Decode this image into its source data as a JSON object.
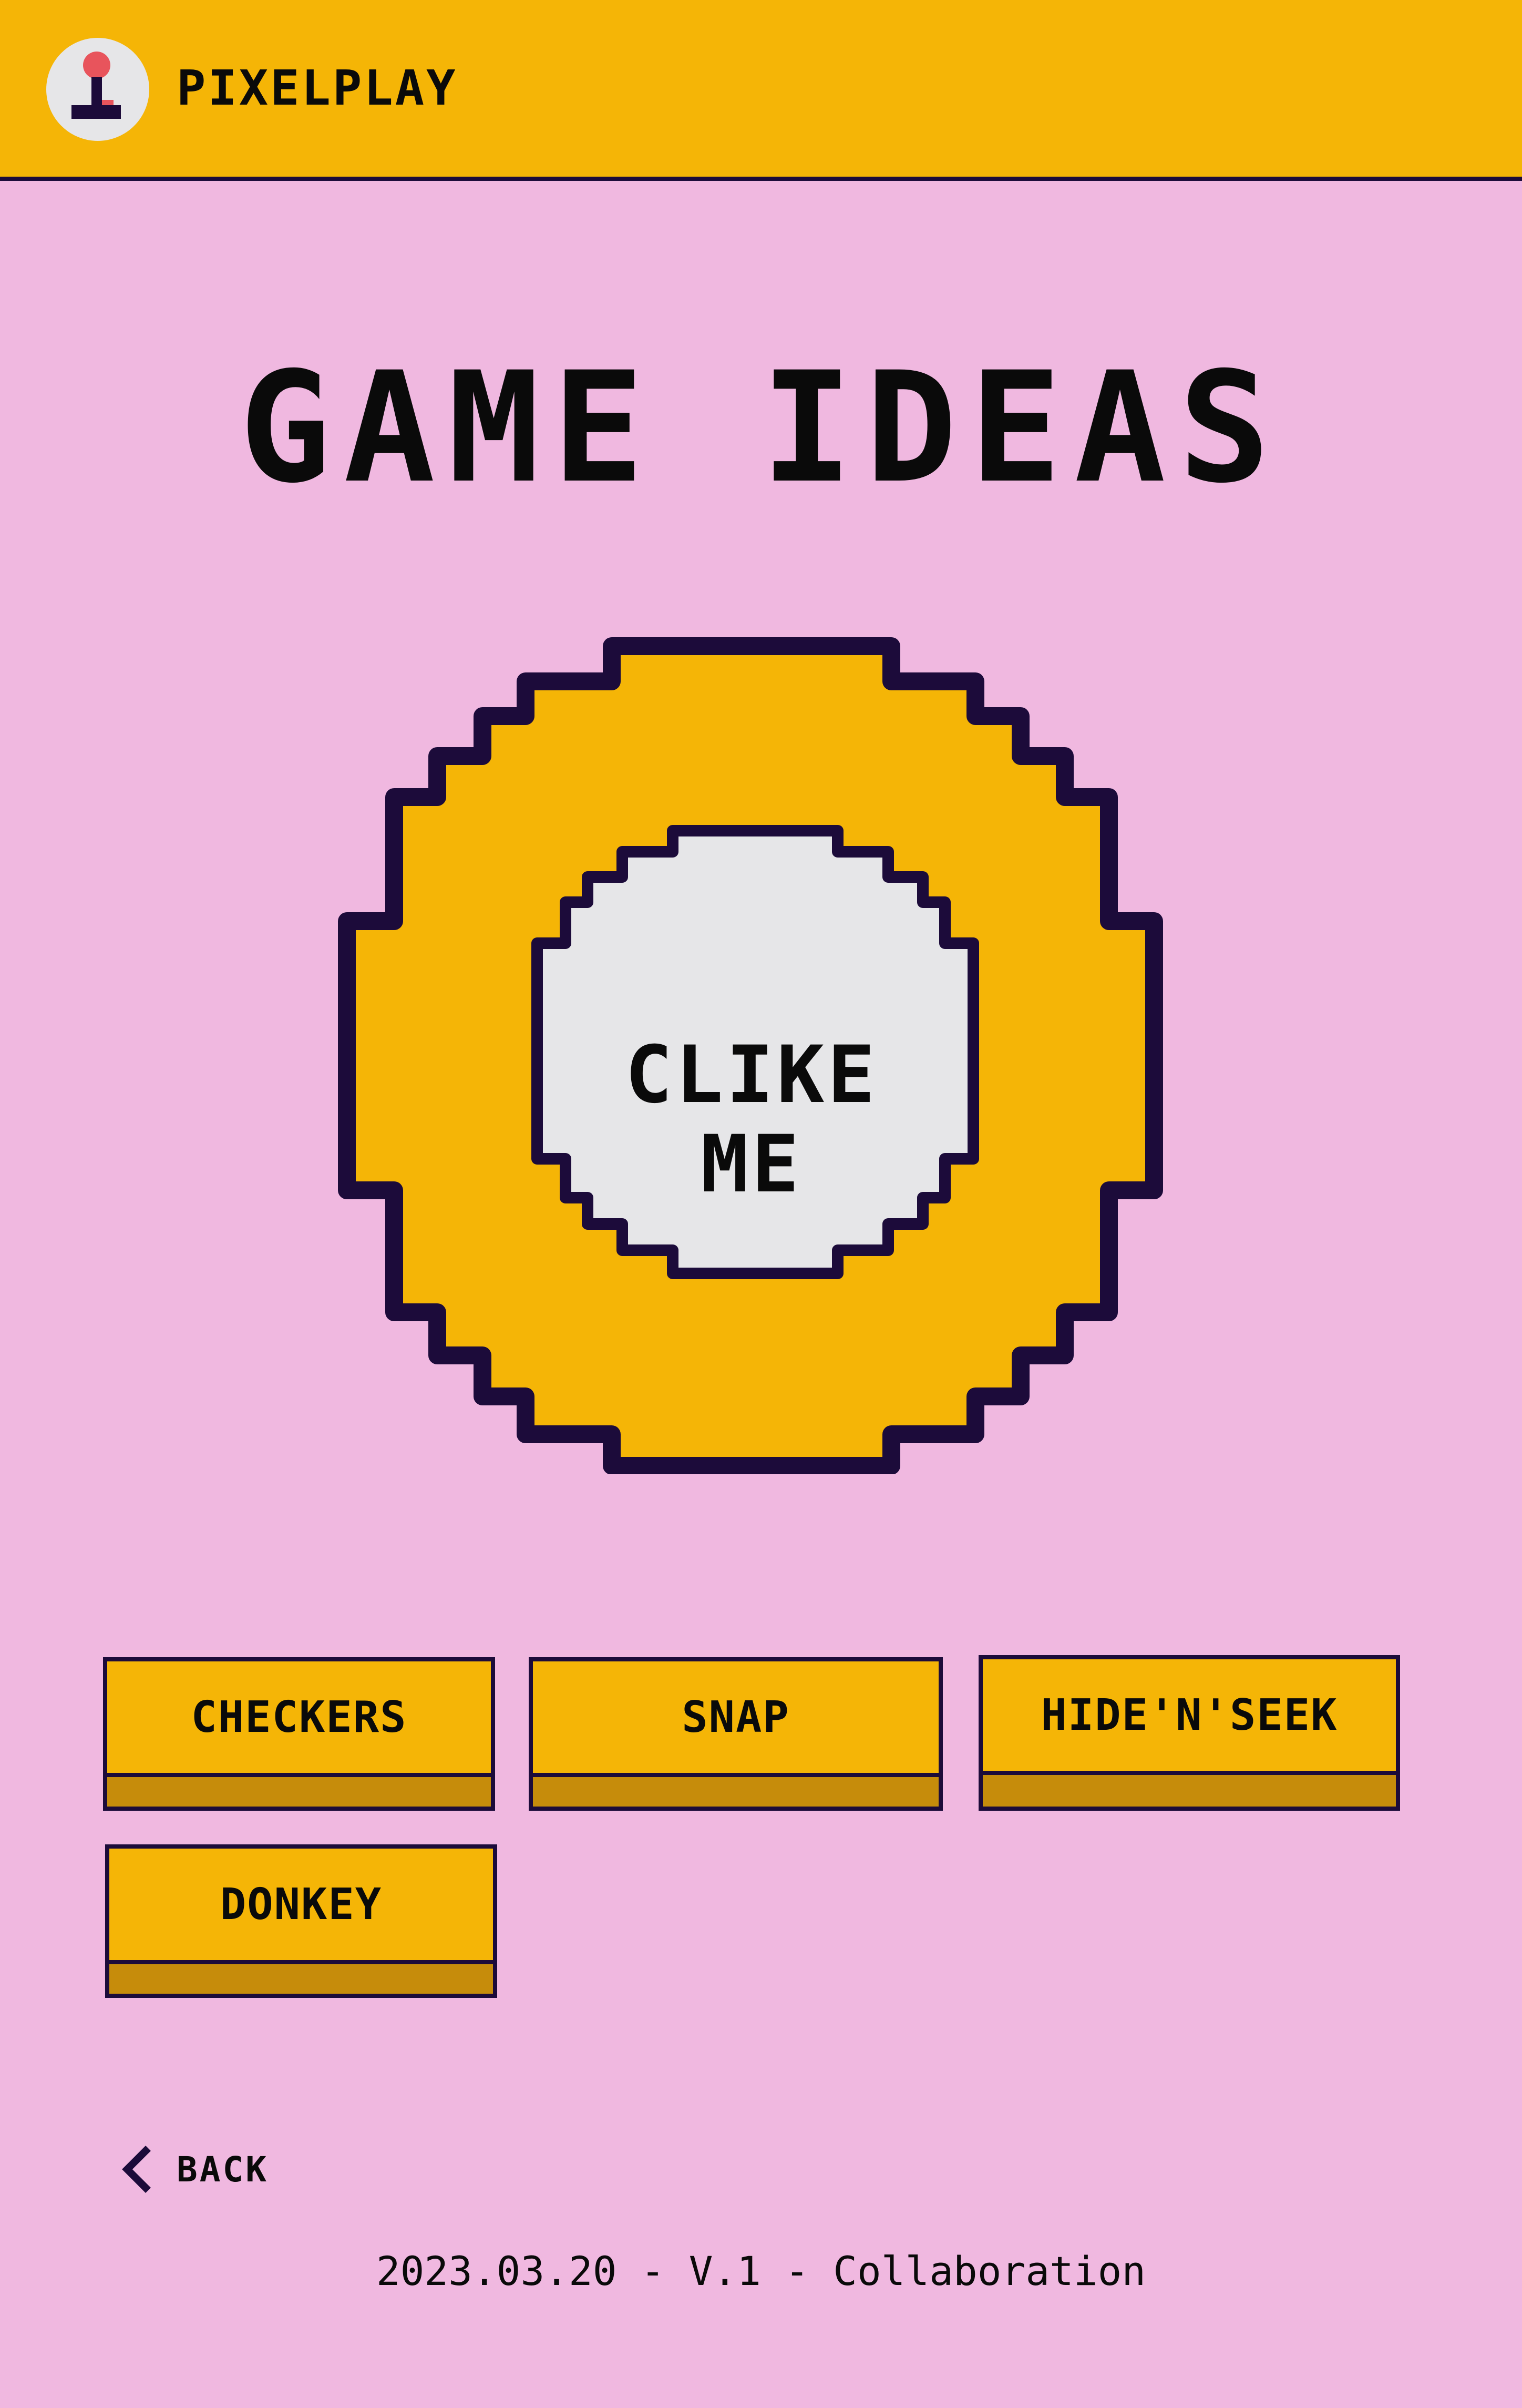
{
  "header": {
    "logo_icon": "joystick-icon",
    "app_name": "PIXELPLAY"
  },
  "main": {
    "title": "GAME IDEAS",
    "coin_button": {
      "line1": "CLIKE",
      "line2": "ME"
    },
    "games": [
      {
        "label": "CHECKERS"
      },
      {
        "label": "SNAP"
      },
      {
        "label": "HIDE'N'SEEK"
      },
      {
        "label": "DONKEY"
      }
    ]
  },
  "navigation": {
    "back_icon": "chevron-left-icon",
    "back_label": "BACK"
  },
  "footer": {
    "text": "2023.03.20 - V.1 - Collaboration"
  },
  "colors": {
    "background": "#f0b8e0",
    "accent_yellow": "#f5b506",
    "button_shadow": "#c68c0b",
    "outline": "#1c0b3a",
    "coin_center": "#e6e6e8",
    "joystick_ball": "#e8545c"
  }
}
